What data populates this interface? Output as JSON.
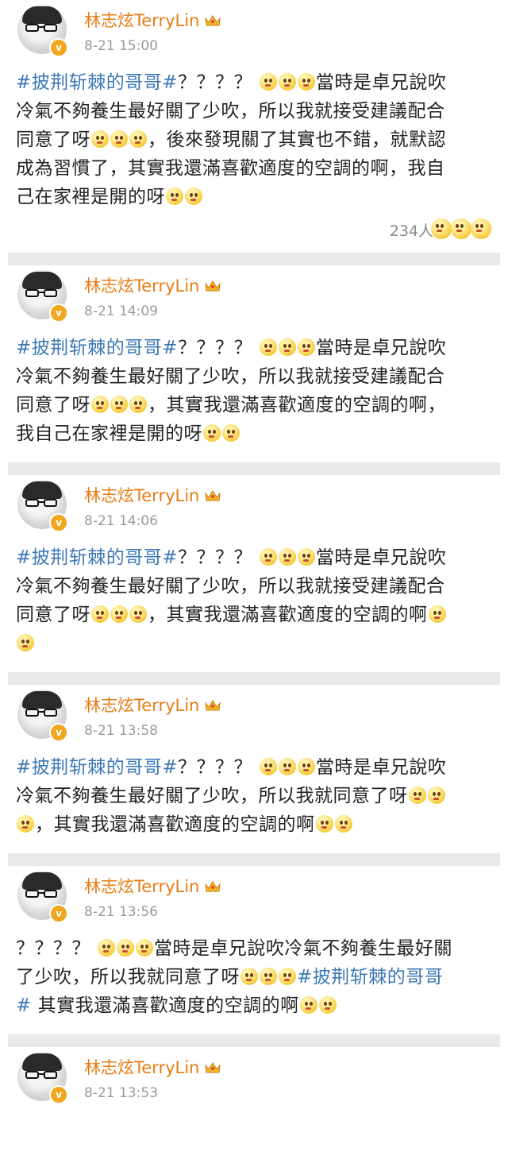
{
  "posts": [
    {
      "name": "林志炫TerryLin",
      "time": "8-21 15:00",
      "lines": [
        [
          "#披荆斩棘的哥哥#",
          "？？？？ ",
          "E3",
          "當時是卓兄說吹"
        ],
        [
          "冷氣不夠養生最好關了少吹，所以我就接受建議配合"
        ],
        [
          "同意了呀",
          "E3",
          "，後來發現關了其實也不錯，就默認"
        ],
        [
          "成為習慣了，其實我還滿喜歡適度的空調的啊，我自"
        ],
        [
          "己在家裡是開的呀",
          "E2"
        ]
      ],
      "reactions": {
        "count": "234人",
        "icons": [
          "surprised-emoji-icon",
          "laughing-emoji-icon",
          "grin-emoji-icon"
        ]
      }
    },
    {
      "name": "林志炫TerryLin",
      "time": "8-21 14:09",
      "lines": [
        [
          "#披荆斩棘的哥哥#",
          "？？？？ ",
          "E3",
          "當時是卓兄說吹"
        ],
        [
          "冷氣不夠養生最好關了少吹，所以我就接受建議配合"
        ],
        [
          "同意了呀",
          "E3",
          "，其實我還滿喜歡適度的空調的啊，"
        ],
        [
          "我自己在家裡是開的呀",
          "E2"
        ]
      ]
    },
    {
      "name": "林志炫TerryLin",
      "time": "8-21 14:06",
      "lines": [
        [
          "#披荆斩棘的哥哥#",
          "？？？？ ",
          "E3",
          "當時是卓兄說吹"
        ],
        [
          "冷氣不夠養生最好關了少吹，所以我就接受建議配合"
        ],
        [
          "同意了呀",
          "E3",
          "，其實我還滿喜歡適度的空調的啊",
          "E1"
        ],
        [
          "E1"
        ]
      ]
    },
    {
      "name": "林志炫TerryLin",
      "time": "8-21 13:58",
      "lines": [
        [
          "#披荆斩棘的哥哥#",
          "？？？？ ",
          "E3",
          "當時是卓兄說吹"
        ],
        [
          "冷氣不夠養生最好關了少吹，所以我就同意了呀",
          "E2"
        ],
        [
          "E1",
          "，其實我還滿喜歡適度的空調的啊",
          "E2"
        ]
      ]
    },
    {
      "name": "林志炫TerryLin",
      "time": "8-21 13:56",
      "lines": [
        [
          "？？？？ ",
          "E3",
          "當時是卓兄說吹冷氣不夠養生最好關"
        ],
        [
          "了少吹，所以我就同意了呀",
          "E3",
          "#披荆斩棘的哥哥"
        ],
        [
          "#",
          " 其實我還滿喜歡適度的空調的啊",
          "E2"
        ]
      ]
    },
    {
      "name": "林志炫TerryLin",
      "time": "8-21 13:53",
      "lines": []
    }
  ],
  "icons": {
    "verified": "v",
    "crown": "crown-icon",
    "emoji": "thinking-emoji-icon"
  },
  "colors": {
    "name": "#e97c14",
    "hashtag": "#3d78b5",
    "separator": "#e9e9e9",
    "badge": "#f0a61e"
  }
}
